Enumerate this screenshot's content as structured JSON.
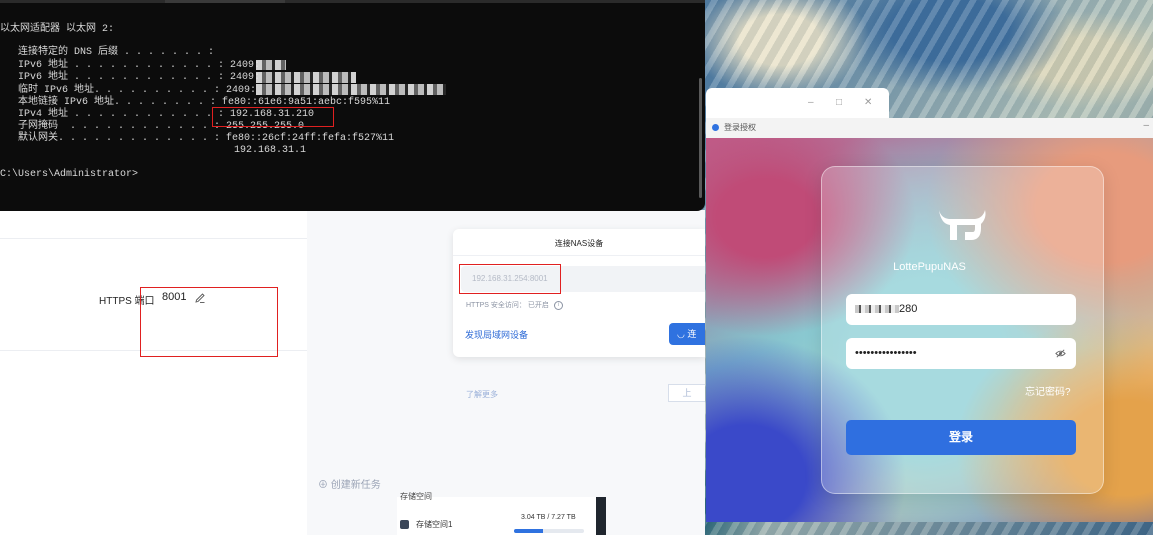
{
  "terminal": {
    "lines": [
      "以太网适配器 以太网 2:",
      "",
      "   连接特定的 DNS 后缀 . . . . . . . :",
      "   IPv6 地址 . . . . . . . . . . . . : 2409:",
      "   IPv6 地址 . . . . . . . . . . . . : 2409:",
      "   临时 IPv6 地址. . . . . . . . . . : 2409:",
      "   本地链接 IPv6 地址. . . . . . . . : fe80::61e6:9a51:aebc:f595%11",
      "   IPv4 地址 . . . . . . . . . . . . : 192.168.31.210",
      "   子网掩码  . . . . . . . . . . . . : 255.255.255.0",
      "   默认网关. . . . . . . . . . . . . : fe80::26cf:24ff:fefa:f527%11",
      "                                       192.168.31.1",
      "",
      "C:\\Users\\Administrator>"
    ]
  },
  "settings": {
    "https_port_label": "HTTPS 端口",
    "https_port_value": "8001"
  },
  "connect_dialog": {
    "title": "连接NAS设备",
    "address_value": "192.168.31.254:8001",
    "https_access_label": "HTTPS 安全访问：",
    "https_access_status": "已开启",
    "discover_link": "发现局域网设备",
    "connect_button": "连",
    "learn_more": "了解更多",
    "prev_button": "上"
  },
  "sidebar": {
    "create_task": "创建新任务"
  },
  "storage": {
    "section_title": "存储空间",
    "item_label": "存储空间1",
    "capacity": "3.04 TB / 7.27 TB",
    "usage_fraction": 0.42
  },
  "window_controls": {
    "minimize": "–",
    "maximize": "□",
    "close": "✕"
  },
  "login": {
    "window_title": "登录授权",
    "minimize": "–",
    "brand": "LottePupuNAS",
    "username_value": "280",
    "password_mask": "••••••••••••••••",
    "forgot_password": "忘记密码?",
    "login_button": "登录"
  }
}
